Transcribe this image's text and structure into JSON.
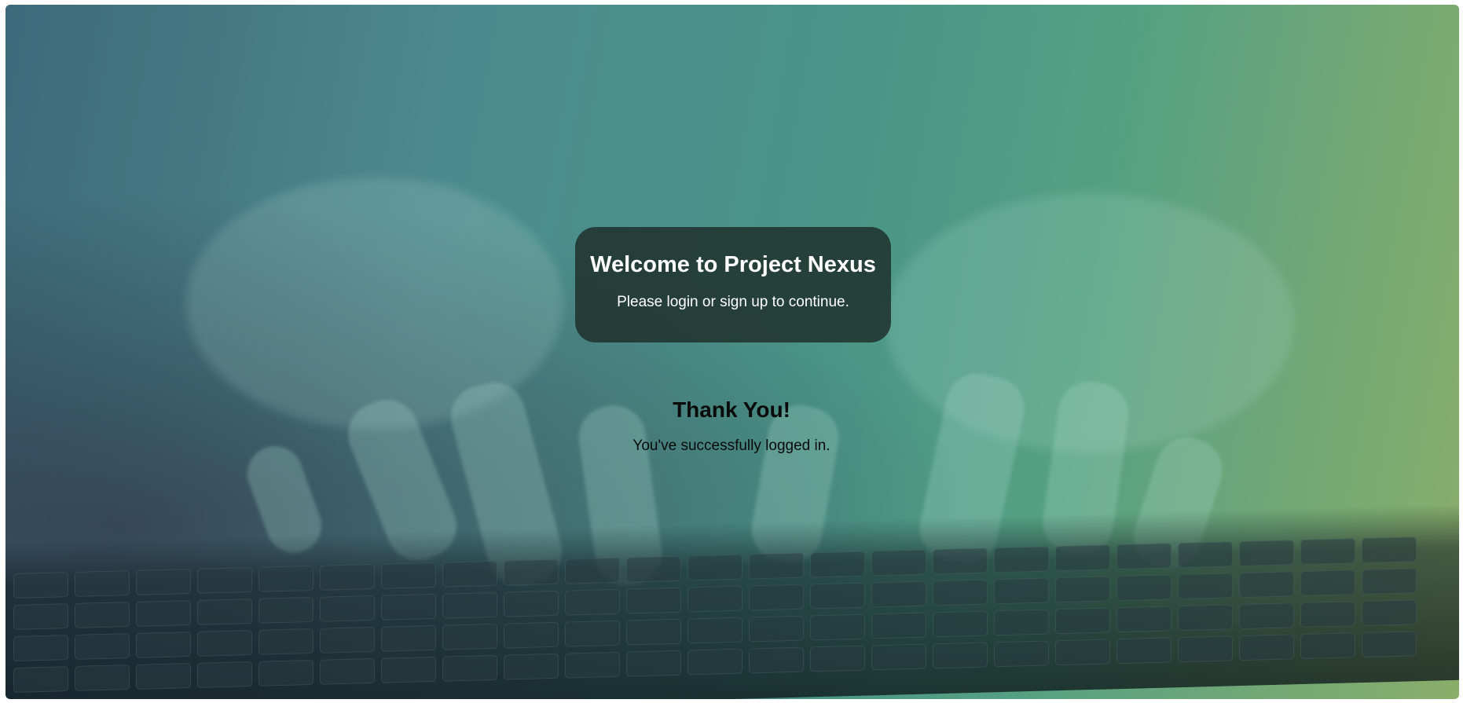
{
  "welcome": {
    "title": "Welcome to Project Nexus",
    "subtitle": "Please login or sign up to continue."
  },
  "confirmation": {
    "title": "Thank You!",
    "message": "You've successfully logged in."
  },
  "background": {
    "image": "hands-typing-on-keyboard",
    "gradient_colors": [
      "#3d6a7a",
      "#4a9487",
      "#8aae6a"
    ]
  }
}
